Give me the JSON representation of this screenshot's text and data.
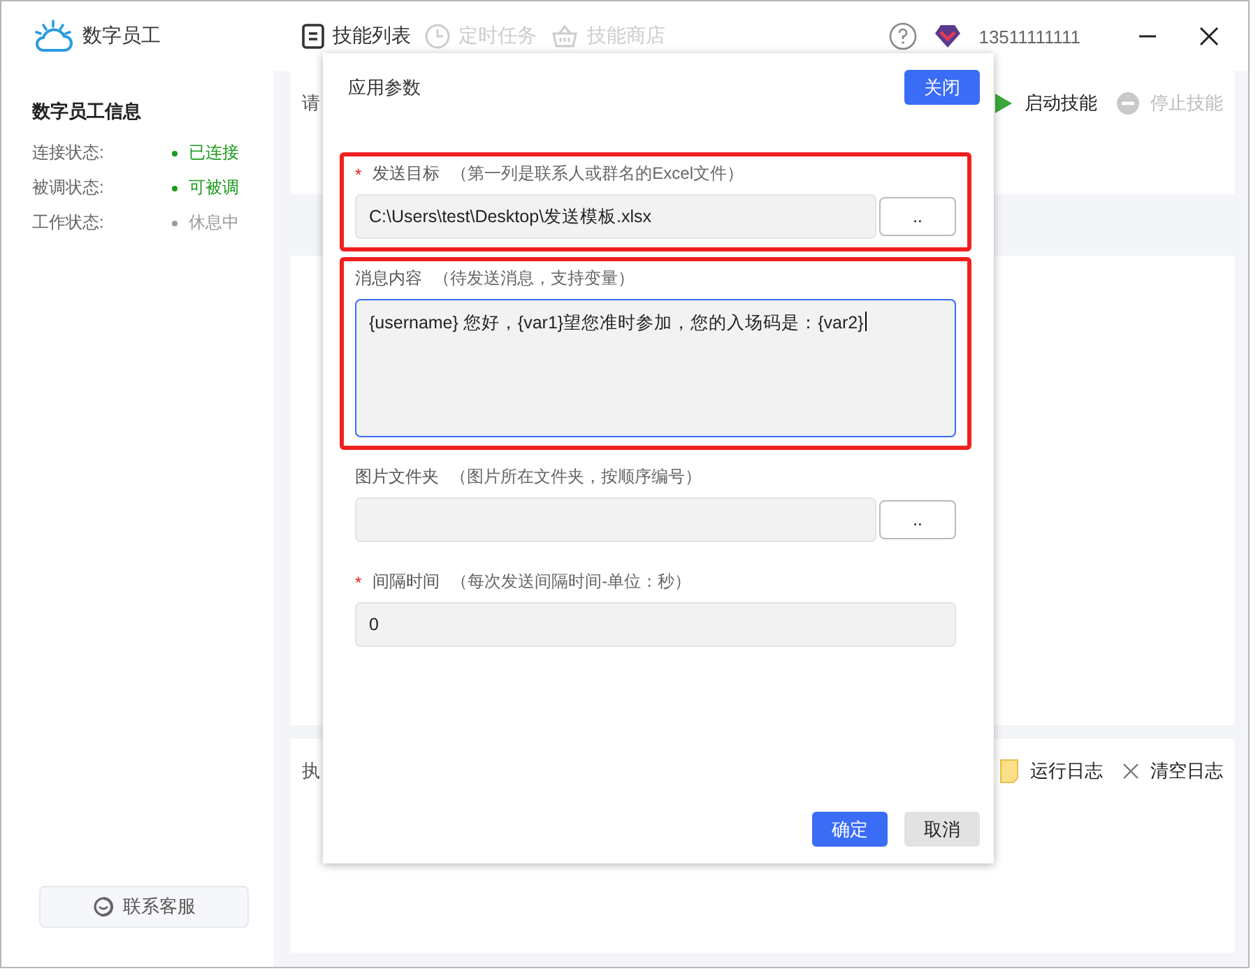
{
  "app": {
    "title": "数字员工"
  },
  "nav": [
    {
      "label": "技能列表",
      "selected": true
    },
    {
      "label": "定时任务",
      "selected": false
    },
    {
      "label": "技能商店",
      "selected": false
    }
  ],
  "header": {
    "account": "13511111111"
  },
  "sidebar": {
    "title": "数字员工信息",
    "status": [
      {
        "label": "连接状态:",
        "value": "已连接",
        "color": "#1a9a1a"
      },
      {
        "label": "被调状态:",
        "value": "可被调",
        "color": "#1a9a1a"
      },
      {
        "label": "工作状态:",
        "value": "休息中",
        "color": "#999999"
      }
    ],
    "support_button": "联系客服"
  },
  "panel": {
    "label": "请",
    "actions": [
      {
        "label": "启动技能",
        "disabled": false
      },
      {
        "label": "停止技能",
        "disabled": true
      }
    ]
  },
  "log_panel": {
    "label": "执",
    "actions": [
      {
        "kind": "log",
        "label": "运行日志"
      },
      {
        "kind": "clear",
        "label": "清空日志"
      }
    ]
  },
  "dialog": {
    "title": "应用参数",
    "close_button": "关闭",
    "required_mark": "*",
    "fields": [
      {
        "kind": "file",
        "label": "发送目标",
        "hint": "（第一列是联系人或群名的Excel文件）",
        "required": true,
        "highlighted": true,
        "focused": false,
        "value": "C:\\Users\\test\\Desktop\\发送模板.xlsx",
        "browse": ".."
      },
      {
        "kind": "textarea",
        "label": "消息内容",
        "hint": "（待发送消息，支持变量）",
        "required": false,
        "highlighted": true,
        "focused": true,
        "value": "{username} 您好，{var1}望您准时参加，您的入场码是：{var2}"
      },
      {
        "kind": "file",
        "label": "图片文件夹",
        "hint": "（图片所在文件夹，按顺序编号）",
        "required": false,
        "highlighted": false,
        "focused": false,
        "browse": ".."
      },
      {
        "kind": "text",
        "label": "间隔时间",
        "hint": "（每次发送间隔时间-单位：秒）",
        "required": true,
        "highlighted": false,
        "focused": false,
        "value": "0"
      }
    ],
    "buttons": [
      {
        "kind": "primary",
        "label": "确定"
      },
      {
        "kind": "secondary",
        "label": "取消"
      }
    ]
  }
}
